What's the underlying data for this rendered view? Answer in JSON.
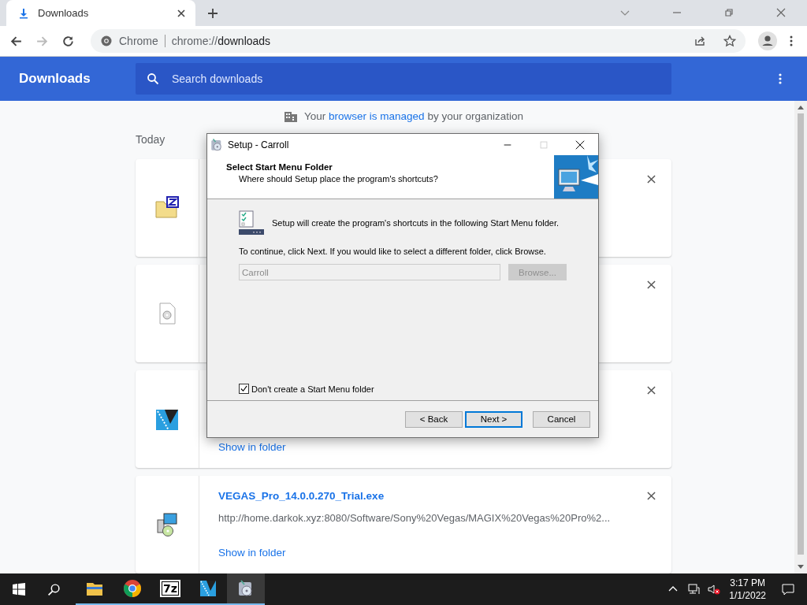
{
  "browser": {
    "tab": {
      "title": "Downloads"
    },
    "address": {
      "site_label": "Chrome",
      "url_scheme": "chrome://",
      "url_path": "downloads"
    }
  },
  "header": {
    "title": "Downloads",
    "search": {
      "placeholder": "Search downloads"
    }
  },
  "managed_notice": {
    "before": "Your",
    "link": "browser is managed",
    "after": "by your organization"
  },
  "date_heading": "Today",
  "downloads": [
    {
      "kind": "zip"
    },
    {
      "kind": "disc"
    },
    {
      "kind": "video",
      "action": "Show in folder"
    },
    {
      "kind": "installer",
      "name": "VEGAS_Pro_14.0.0.270_Trial.exe",
      "url": "http://home.darkok.xyz:8080/Software/Sony%20Vegas/MAGIX%20Vegas%20Pro%2...",
      "action": "Show in folder"
    }
  ],
  "dialog": {
    "title": "Setup - Carroll",
    "heading": "Select Start Menu Folder",
    "subheading": "Where should Setup place the program's shortcuts?",
    "info": "Setup will create the program's shortcuts in the following Start Menu folder.",
    "instruction": "To continue, click Next. If you would like to select a different folder, click Browse.",
    "folder": {
      "value": "Carroll",
      "disabled": true
    },
    "browse": {
      "label": "Browse...",
      "disabled": true
    },
    "no_folder": {
      "label": "Don't create a Start Menu folder",
      "checked": true
    },
    "buttons": [
      {
        "label": "< Back",
        "default": false
      },
      {
        "label": "Next >",
        "default": true
      },
      {
        "label": "Cancel",
        "default": false
      }
    ]
  },
  "taskbar": {
    "items": [
      {
        "kind": "explorer",
        "running": true,
        "selected": false
      },
      {
        "kind": "chrome",
        "running": true,
        "selected": false
      },
      {
        "kind": "sevenzip",
        "label": "7z",
        "running": true,
        "selected": false
      },
      {
        "kind": "video",
        "running": true,
        "selected": false
      },
      {
        "kind": "setup",
        "running": true,
        "selected": true
      }
    ],
    "time": "3:17 PM",
    "date": "1/1/2022"
  }
}
